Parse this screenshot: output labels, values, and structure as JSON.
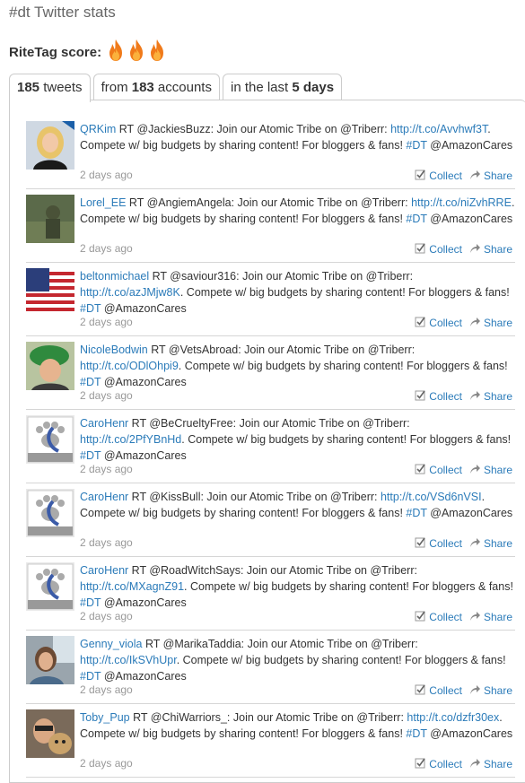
{
  "header": {
    "title": "#dt Twitter stats"
  },
  "ritetag": {
    "label": "RiteTag score:",
    "flames": 3
  },
  "tabs": [
    {
      "pre": "",
      "num": "185",
      "post": " tweets"
    },
    {
      "pre": "from ",
      "num": "183",
      "post": " accounts"
    },
    {
      "pre": "in the last ",
      "num": "5 days",
      "post": ""
    }
  ],
  "actions": {
    "collect": "Collect",
    "share": "Share"
  },
  "tweets": [
    {
      "user": "QRKim",
      "pre": " RT @JackiesBuzz: Join our Atomic Tribe on @Triberr: ",
      "link": "http://t.co/Avvhwf3T",
      "post": ". Compete w/ big budgets by sharing content! For bloggers & fans! ",
      "hashtag": "#DT",
      "tail": " @AmazonCares",
      "time": "2 days ago"
    },
    {
      "user": "Lorel_EE",
      "pre": " RT @AngiemAngela: Join our Atomic Tribe on @Triberr: ",
      "link": "http://t.co/niZvhRRE",
      "post": ". Compete w/ big budgets by sharing content! For bloggers & fans! ",
      "hashtag": "#DT",
      "tail": " @AmazonCares",
      "time": "2 days ago"
    },
    {
      "user": "beltonmichael",
      "pre": " RT @saviour316: Join our Atomic Tribe on @Triberr: ",
      "link": "http://t.co/azJMjw8K",
      "post": ". Compete w/ big budgets by sharing content! For bloggers & fans! ",
      "hashtag": "#DT",
      "tail": " @AmazonCares",
      "time": "2 days ago"
    },
    {
      "user": "NicoleBodwin",
      "pre": " RT @VetsAbroad: Join our Atomic Tribe on @Triberr: ",
      "link": "http://t.co/ODlOhpi9",
      "post": ". Compete w/ big budgets by sharing content! For bloggers & fans! ",
      "hashtag": "#DT",
      "tail": " @AmazonCares",
      "time": "2 days ago"
    },
    {
      "user": "CaroHenr",
      "pre": " RT @BeCrueltyFree: Join our Atomic Tribe on @Triberr: ",
      "link": "http://t.co/2PfYBnHd",
      "post": ". Compete w/ big budgets by sharing content! For bloggers & fans! ",
      "hashtag": "#DT",
      "tail": " @AmazonCares",
      "time": "2 days ago"
    },
    {
      "user": "CaroHenr",
      "pre": " RT @KissBull: Join our Atomic Tribe on @Triberr: ",
      "link": "http://t.co/VSd6nVSI",
      "post": ". Compete w/ big budgets by sharing content! For bloggers & fans! ",
      "hashtag": "#DT",
      "tail": " @AmazonCares",
      "time": "2 days ago"
    },
    {
      "user": "CaroHenr",
      "pre": " RT @RoadWitchSays: Join our Atomic Tribe on @Triberr: ",
      "link": "http://t.co/MXagnZ91",
      "post": ". Compete w/ big budgets by sharing content! For bloggers & fans! ",
      "hashtag": "#DT",
      "tail": " @AmazonCares",
      "time": "2 days ago"
    },
    {
      "user": "Genny_viola",
      "pre": " RT @MarikaTaddia: Join our Atomic Tribe on @Triberr: ",
      "link": "http://t.co/IkSVhUpr",
      "post": ". Compete w/ big budgets by sharing content! For bloggers & fans! ",
      "hashtag": "#DT",
      "tail": " @AmazonCares",
      "time": "2 days ago"
    },
    {
      "user": "Toby_Pup",
      "pre": " RT @ChiWarriors_: Join our Atomic Tribe on @Triberr: ",
      "link": "http://t.co/dzfr30ex",
      "post": ". Compete w/ big budgets by sharing content! For bloggers & fans! ",
      "hashtag": "#DT",
      "tail": " @AmazonCares",
      "time": "2 days ago"
    }
  ],
  "avatars": [
    "photo-blonde-woman",
    "photo-soldier",
    "us-flag",
    "photo-woman-green-hat",
    "save-lennox-logo",
    "save-lennox-logo",
    "save-lennox-logo",
    "photo-woman-window",
    "photo-man-with-dog"
  ],
  "colors": {
    "link": "#2b7bb9",
    "text": "#333333",
    "muted": "#999999",
    "flame": "#f07a1a"
  }
}
